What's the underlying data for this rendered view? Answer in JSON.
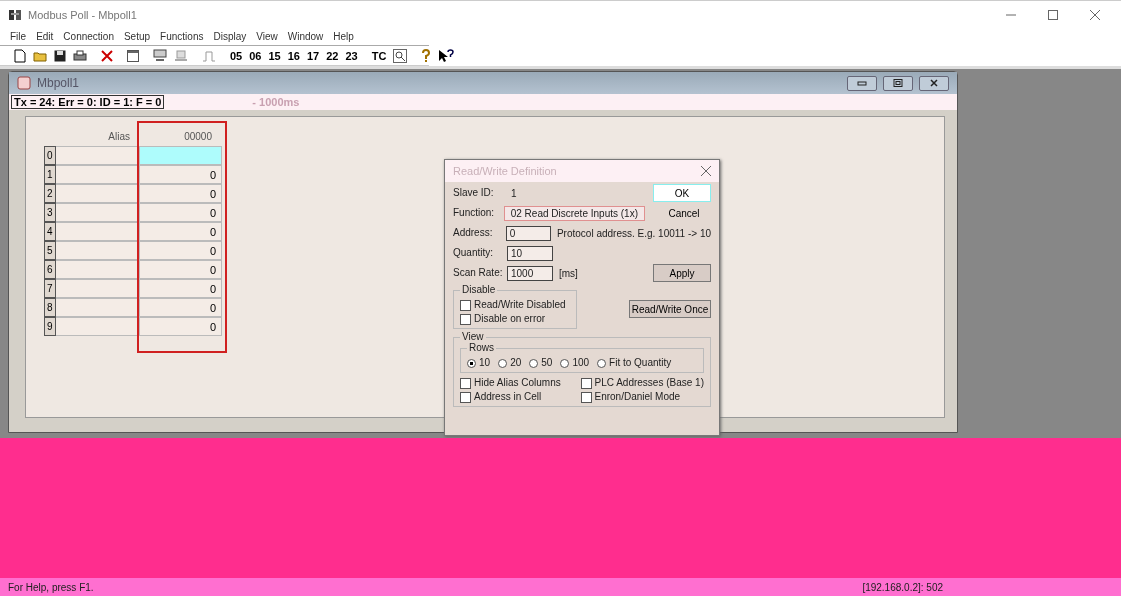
{
  "window": {
    "title": "Modbus Poll - Mbpoll1"
  },
  "menu": [
    "File",
    "Edit",
    "Connection",
    "Setup",
    "Functions",
    "Display",
    "View",
    "Window",
    "Help"
  ],
  "toolbar": {
    "function_codes": [
      "05",
      "06",
      "15",
      "16",
      "17",
      "22",
      "23"
    ],
    "tc": "TC"
  },
  "child": {
    "title": "Mbpoll1",
    "status_left": "Tx = 24: Err = 0: ID = 1: F = 0",
    "status_right": "- 1000ms",
    "grid": {
      "alias_header": "Alias",
      "value_header": "00000",
      "rows": [
        {
          "index": "0",
          "selected": true
        },
        {
          "index": "1",
          "value": "0",
          "selected": false
        },
        {
          "index": "2",
          "value": "0",
          "selected": false
        },
        {
          "index": "3",
          "value": "0",
          "selected": false
        },
        {
          "index": "4",
          "value": "0",
          "selected": false
        },
        {
          "index": "5",
          "value": "0",
          "selected": false
        },
        {
          "index": "6",
          "value": "0",
          "selected": false
        },
        {
          "index": "7",
          "value": "0",
          "selected": false
        },
        {
          "index": "8",
          "value": "0",
          "selected": false
        },
        {
          "index": "9",
          "value": "0",
          "selected": false
        }
      ]
    }
  },
  "dialog": {
    "title": "Read/Write Definition",
    "slave_label": "Slave ID:",
    "slave_value": "1",
    "function_label": "Function:",
    "function_value": "02 Read Discrete Inputs (1x)",
    "address_label": "Address:",
    "address_value": "0",
    "address_hint": "Protocol address. E.g. 10011 -> 10",
    "quantity_label": "Quantity:",
    "quantity_value": "10",
    "scan_label": "Scan Rate:",
    "scan_value": "1000",
    "scan_unit": "[ms]",
    "ok": "OK",
    "cancel": "Cancel",
    "apply": "Apply",
    "once": "Read/Write Once",
    "disable_group": "Disable",
    "disable_options": [
      {
        "label": "Read/Write Disabled",
        "checked": false
      },
      {
        "label": "Disable on error",
        "checked": false
      }
    ],
    "view_group": "View",
    "rows_group": "Rows",
    "rows_options": [
      {
        "label": "10",
        "selected": true
      },
      {
        "label": "20",
        "selected": false
      },
      {
        "label": "50",
        "selected": false
      },
      {
        "label": "100",
        "selected": false
      },
      {
        "label": "Fit to Quantity",
        "selected": false
      }
    ],
    "view_options": [
      {
        "label": "Hide Alias Columns",
        "checked": false
      },
      {
        "label": "PLC Addresses (Base 1)",
        "checked": false
      },
      {
        "label": "Address in Cell",
        "checked": false
      },
      {
        "label": "Enron/Daniel Mode",
        "checked": false
      }
    ]
  },
  "status_bar": {
    "help": "For Help, press F1.",
    "connection": "[192.168.0.2]: 502"
  }
}
